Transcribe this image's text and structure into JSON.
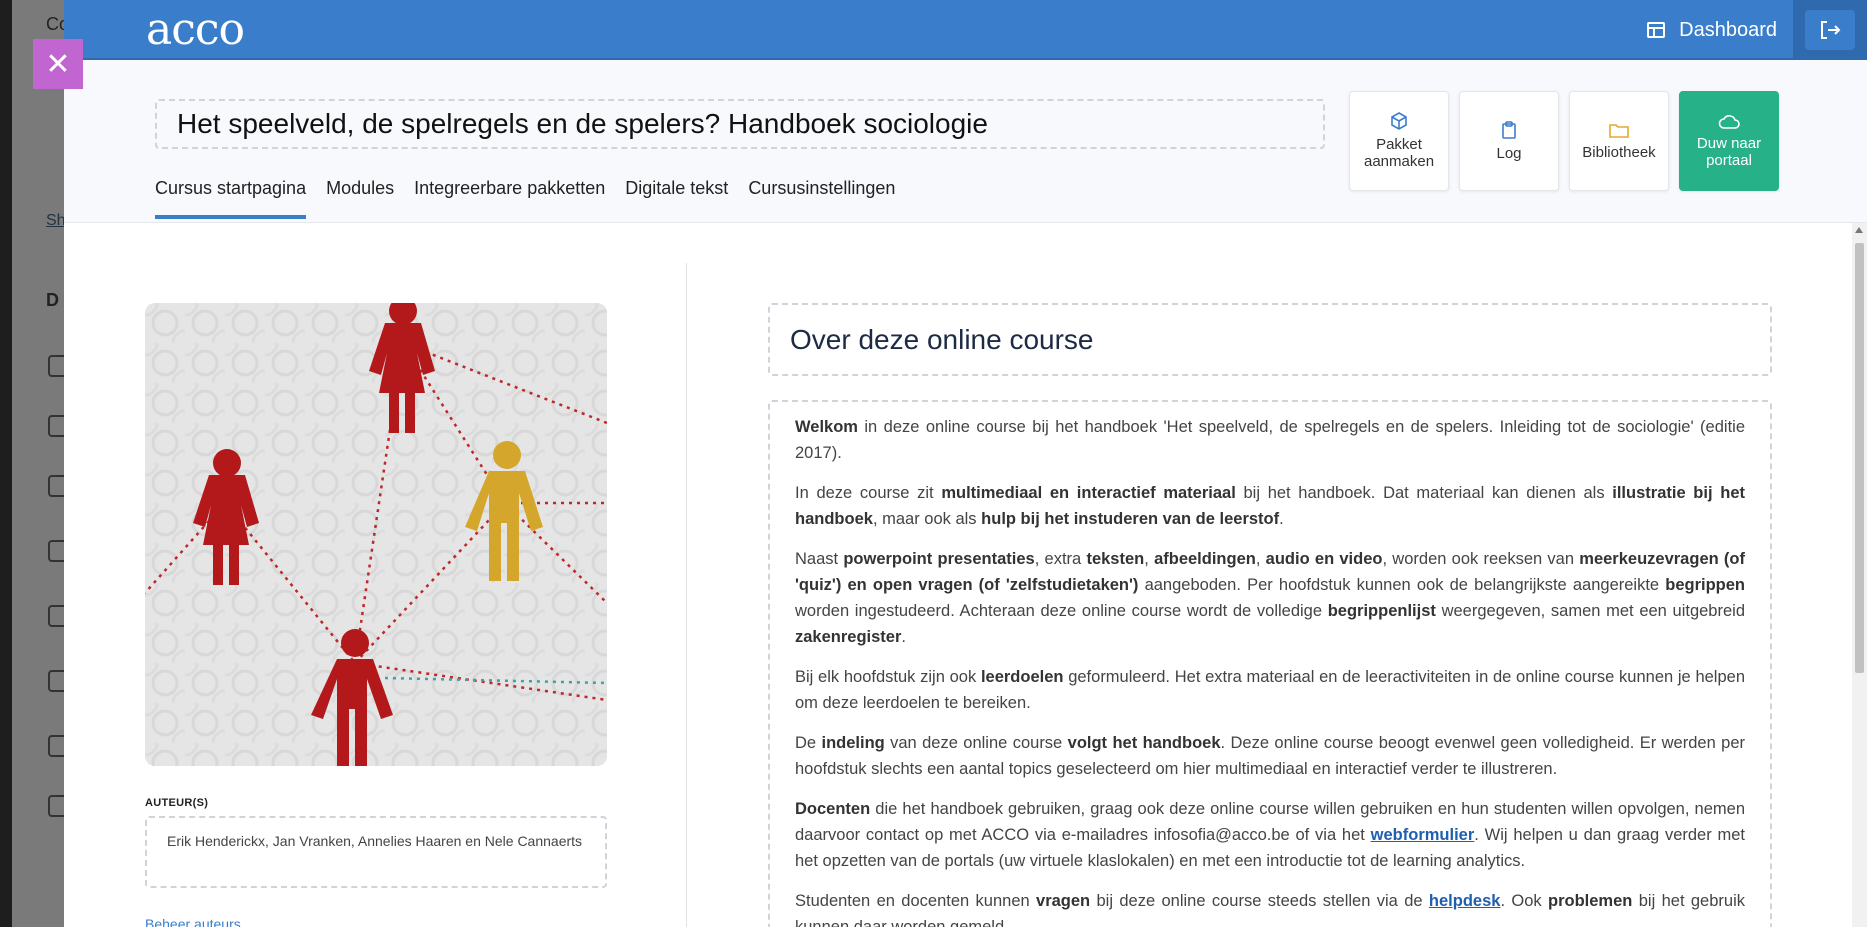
{
  "background": {
    "title_fragment": "Co",
    "link_fragment": "Sh",
    "section_fragment": "D"
  },
  "topbar": {
    "logo": "acco",
    "dashboard_label": "Dashboard",
    "logout_icon": "logout-icon"
  },
  "close_icon": "close-icon",
  "course": {
    "title": "Het speelveld, de spelregels en de spelers? Handboek sociologie"
  },
  "tabs": [
    {
      "label": "Cursus startpagina",
      "active": true
    },
    {
      "label": "Modules",
      "active": false
    },
    {
      "label": "Integreerbare pakketten",
      "active": false
    },
    {
      "label": "Digitale tekst",
      "active": false
    },
    {
      "label": "Cursusinstellingen",
      "active": false
    }
  ],
  "actions": [
    {
      "label": "Pakket aanmaken",
      "icon": "package-icon"
    },
    {
      "label": "Log",
      "icon": "clipboard-icon"
    },
    {
      "label": "Bibliotheek",
      "icon": "folder-icon"
    },
    {
      "label": "Duw naar portaal",
      "icon": "cloud-icon",
      "color": "#26b189"
    }
  ],
  "authors": {
    "label": "AUTEUR(S)",
    "names": "Erik Henderickx, Jan Vranken, Annelies Haaren en Nele Cannaerts",
    "manage_link": "Beheer auteurs"
  },
  "about": {
    "title": "Over deze online course"
  },
  "colors": {
    "brand": "#3a7ecb",
    "primary_action": "#26b189",
    "close": "#c166d0",
    "figure_red": "#b3191b",
    "figure_yellow": "#d4a72c"
  }
}
